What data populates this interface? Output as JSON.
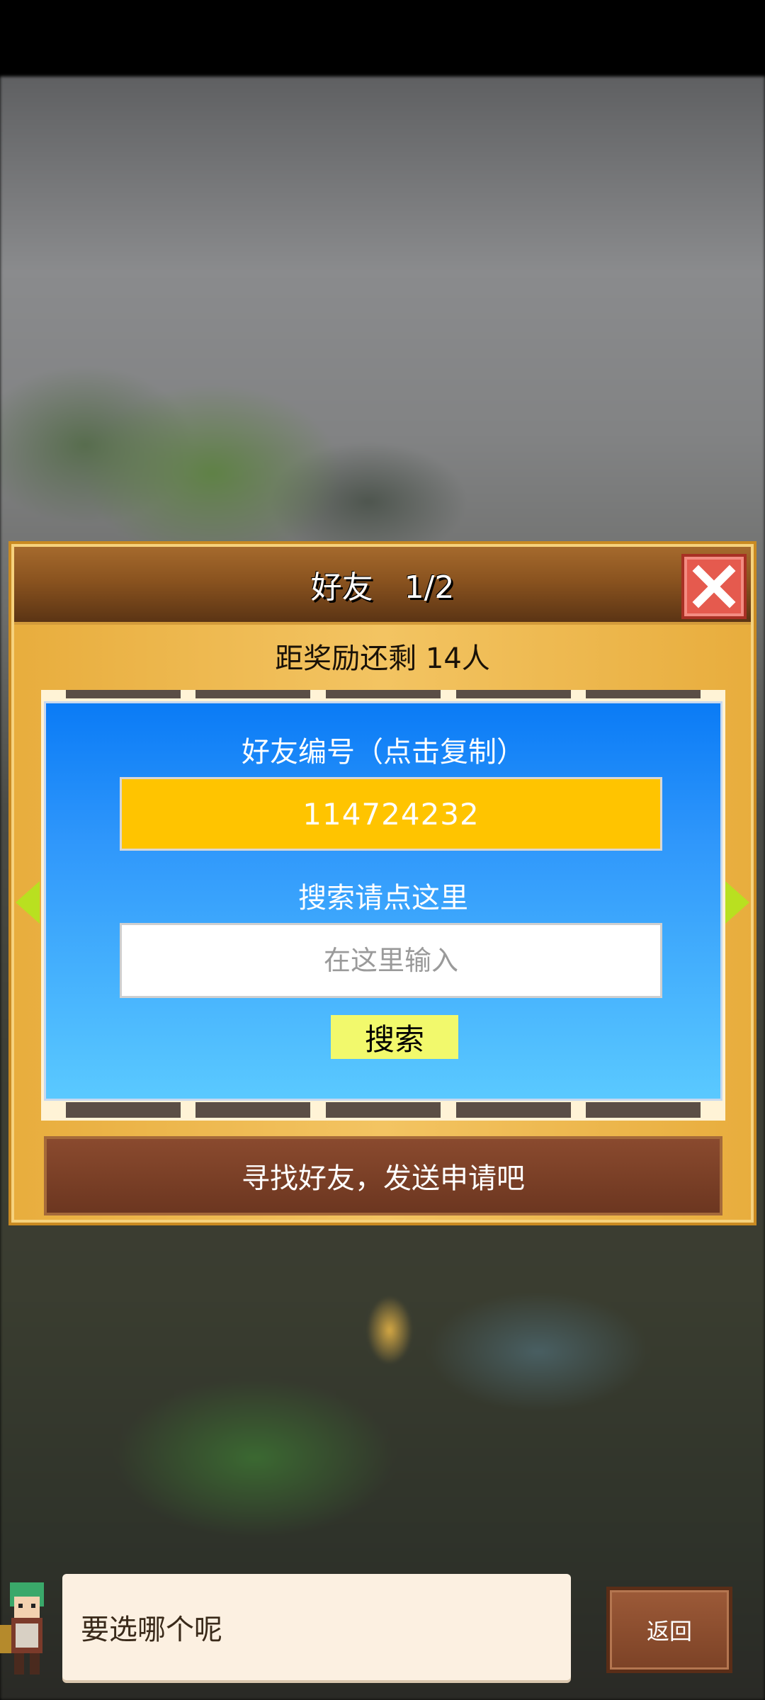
{
  "dialog": {
    "title": "好友　1/2",
    "reward_text": "距奖励还剩 14人",
    "friend_id_label": "好友编号（点击复制）",
    "friend_id": "114724232",
    "search_label": "搜索请点这里",
    "search_placeholder": "在这里输入",
    "search_button": "搜索",
    "find_friends_button": "寻找好友，发送申请吧",
    "close_icon": "close-icon",
    "nav_icons": [
      "chevron-left-icon",
      "chevron-right-icon"
    ]
  },
  "bottom": {
    "speech_text": "要选哪个呢",
    "back_button": "返回"
  },
  "colors": {
    "id_box": "#ffc400",
    "search_button": "#f2f96c",
    "close_button": "#e55a4e",
    "panel_blue": "#2f97fb"
  }
}
